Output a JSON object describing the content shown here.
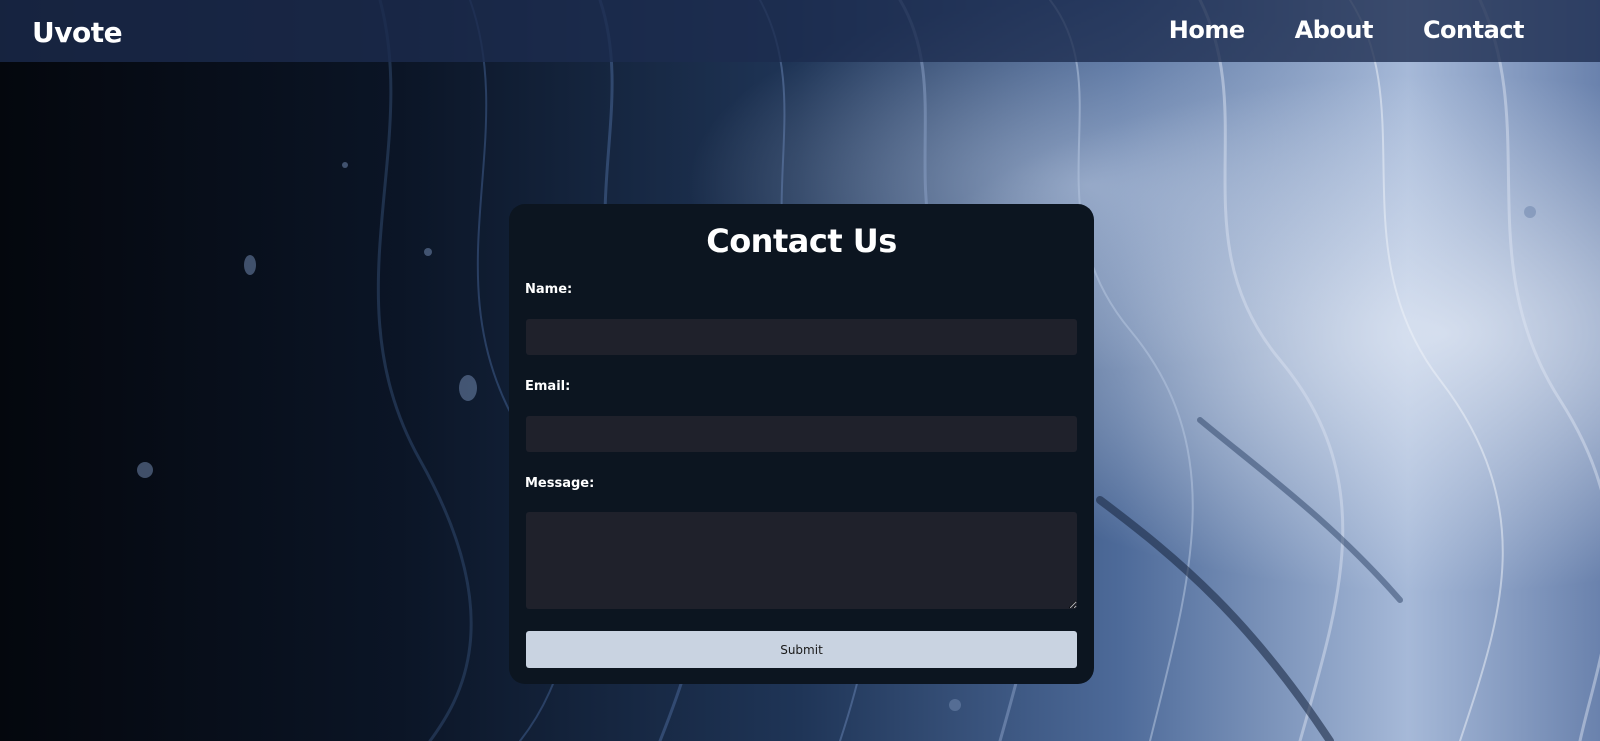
{
  "app": {
    "brand": "Uvote"
  },
  "nav": {
    "items": [
      {
        "label": "Home"
      },
      {
        "label": "About"
      },
      {
        "label": "Contact"
      }
    ]
  },
  "contact_form": {
    "title": "Contact Us",
    "name_label": "Name:",
    "name_value": "",
    "email_label": "Email:",
    "email_value": "",
    "message_label": "Message:",
    "message_value": "",
    "submit_label": "Submit"
  },
  "colors": {
    "navbar": "#1c2c4e",
    "card": "#0c1520",
    "input": "#1f212b",
    "button": "#c9d3e1"
  }
}
